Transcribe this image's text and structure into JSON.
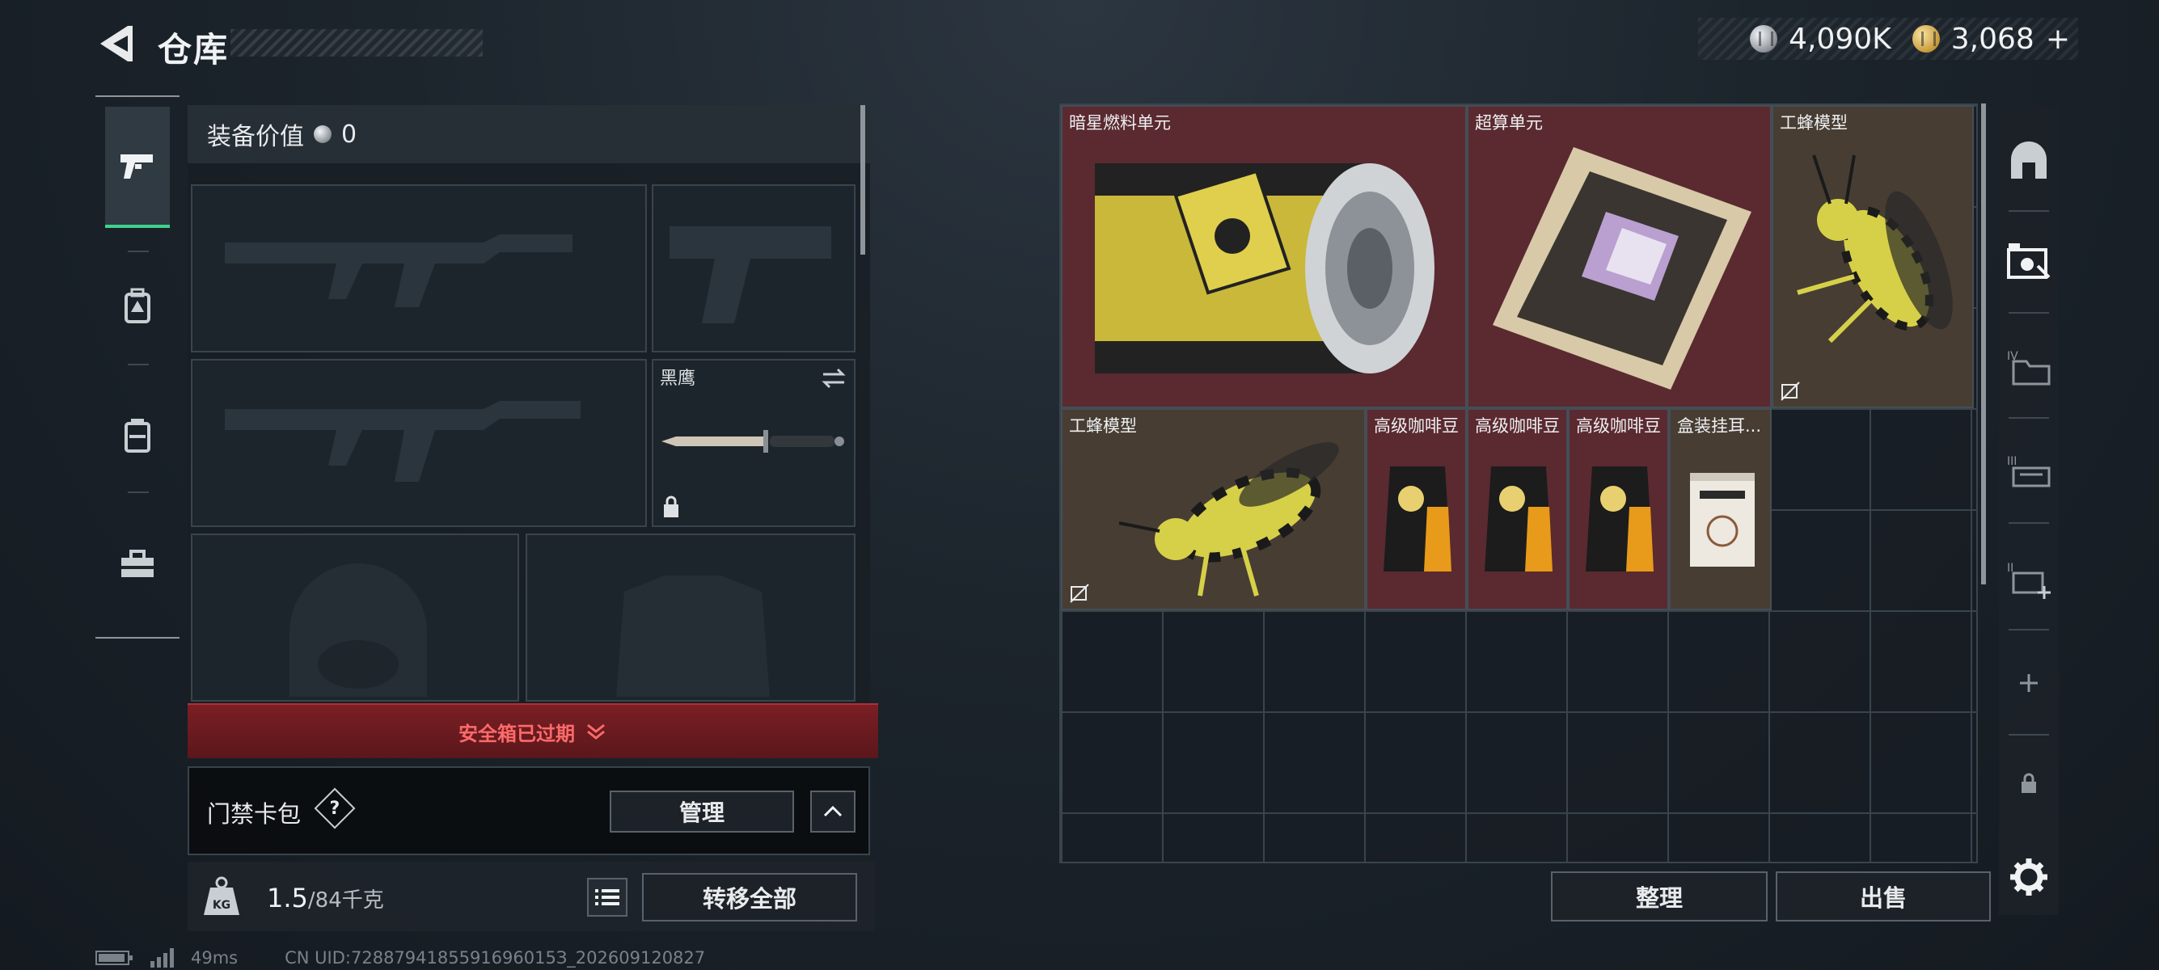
{
  "header": {
    "title": "仓库",
    "currency_silver": "4,090K",
    "currency_gold": "3,068",
    "currency_add": "+"
  },
  "nav": {
    "items": [
      {
        "name": "weapons",
        "icon": "pistol-icon",
        "active": true
      },
      {
        "name": "armor",
        "icon": "backpack-icon",
        "active": false
      },
      {
        "name": "containers",
        "icon": "chest-rig-icon",
        "active": false
      },
      {
        "name": "toolbox",
        "icon": "toolbox-icon",
        "active": false
      }
    ]
  },
  "equipment": {
    "value_label": "装备价值",
    "value": "0",
    "melee_label": "黑鹰",
    "expired_text": "安全箱已过期"
  },
  "card_wallet": {
    "label": "门禁卡包",
    "help": "?",
    "manage_label": "管理"
  },
  "weight": {
    "current": "1.5",
    "capacity": "/84千克",
    "icon_label": "KG",
    "transfer_all_label": "转移全部"
  },
  "status": {
    "ping": "49ms",
    "uid": "CN UID:7288794185591696015З_202609120827"
  },
  "storage": {
    "items": [
      {
        "name": "暗星燃料单元",
        "color": "red",
        "no_trade": false
      },
      {
        "name": "超算单元",
        "color": "red",
        "no_trade": false
      },
      {
        "name": "工蜂模型",
        "color": "brown",
        "no_trade": true
      },
      {
        "name": "工蜂模型",
        "color": "brown",
        "no_trade": true
      },
      {
        "name": "高级咖啡豆",
        "color": "red",
        "no_trade": false
      },
      {
        "name": "高级咖啡豆",
        "color": "red",
        "no_trade": false
      },
      {
        "name": "高级咖啡豆",
        "color": "red",
        "no_trade": false
      },
      {
        "name": "盒装挂耳...",
        "color": "brown",
        "no_trade": false
      }
    ],
    "sort_label": "整理",
    "sell_label": "出售"
  },
  "colors": {
    "accent_green": "#3fd38c",
    "rarity_red": "#5a2a30",
    "rarity_brown": "#473d33",
    "alert_red": "#ff6a6a"
  }
}
